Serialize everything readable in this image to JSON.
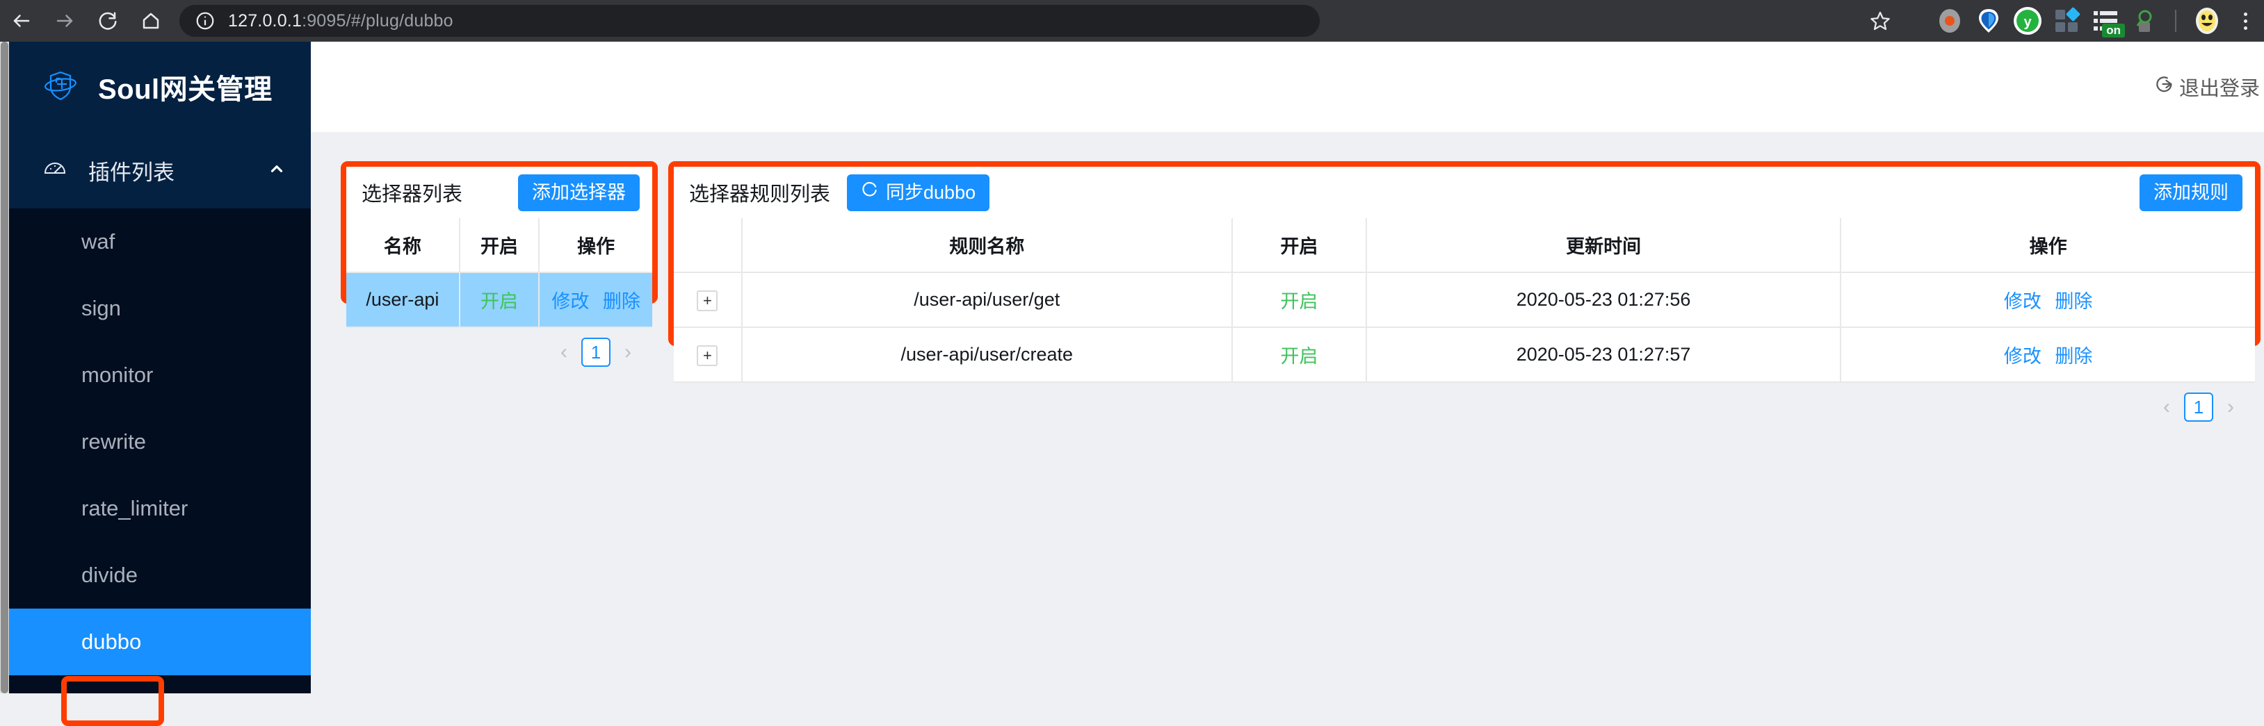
{
  "browser": {
    "url_main": "127.0.0.1",
    "url_rest": ":9095/#/plug/dubbo",
    "back_icon": "back-arrow-icon",
    "forward_icon": "forward-arrow-icon",
    "reload_icon": "reload-icon",
    "home_icon": "home-icon",
    "info_icon": "site-info-icon",
    "star_icon": "bookmark-star-icon",
    "extensions": [
      "extension-icon-orange-dot",
      "extension-icon-blue-drop",
      "extension-icon-green-y",
      "extension-icon-blue-squares",
      "extension-icon-list-on",
      "extension-icon-magnifier"
    ],
    "ext_badge": "on",
    "profile_icon": "profile-avatar-icon",
    "menu_icon": "chrome-menu-icon"
  },
  "sidebar": {
    "brand": "Soul网关管理",
    "brand_logo": "soul-shield-logo",
    "group": {
      "label": "插件列表",
      "icon": "dashboard-gauge-icon",
      "collapse_icon": "chevron-up-icon"
    },
    "items": [
      {
        "label": "waf",
        "selected": false
      },
      {
        "label": "sign",
        "selected": false
      },
      {
        "label": "monitor",
        "selected": false
      },
      {
        "label": "rewrite",
        "selected": false
      },
      {
        "label": "rate_limiter",
        "selected": false
      },
      {
        "label": "divide",
        "selected": false
      },
      {
        "label": "dubbo",
        "selected": true
      }
    ]
  },
  "topbar": {
    "logout_label": "退出登录",
    "logout_icon": "logout-icon"
  },
  "selector_panel": {
    "title": "选择器列表",
    "add_button": "添加选择器",
    "columns": [
      "名称",
      "开启",
      "操作"
    ],
    "rows": [
      {
        "name": "/user-api",
        "status": "开启",
        "edit": "修改",
        "delete": "删除",
        "selected": true
      }
    ],
    "pagination": {
      "prev": "‹",
      "page": "1",
      "next": "›"
    }
  },
  "rule_panel": {
    "title": "选择器规则列表",
    "sync_button": "同步dubbo",
    "sync_icon": "refresh-icon",
    "add_button": "添加规则",
    "columns": [
      "",
      "规则名称",
      "开启",
      "更新时间",
      "操作"
    ],
    "rows": [
      {
        "expand": "+",
        "name": "/user-api/user/get",
        "status": "开启",
        "updated": "2020-05-23 01:27:56",
        "edit": "修改",
        "delete": "删除"
      },
      {
        "expand": "+",
        "name": "/user-api/user/create",
        "status": "开启",
        "updated": "2020-05-23 01:27:57",
        "edit": "修改",
        "delete": "删除"
      }
    ],
    "pagination": {
      "prev": "‹",
      "page": "1",
      "next": "›"
    }
  },
  "colors": {
    "brand_blue": "#1890ff",
    "sidebar_dark": "#020d1f",
    "sidebar_header": "#052142",
    "annotation_red": "#ff3d00",
    "status_green": "#3fc35b",
    "row_selected": "#91d2ff"
  }
}
